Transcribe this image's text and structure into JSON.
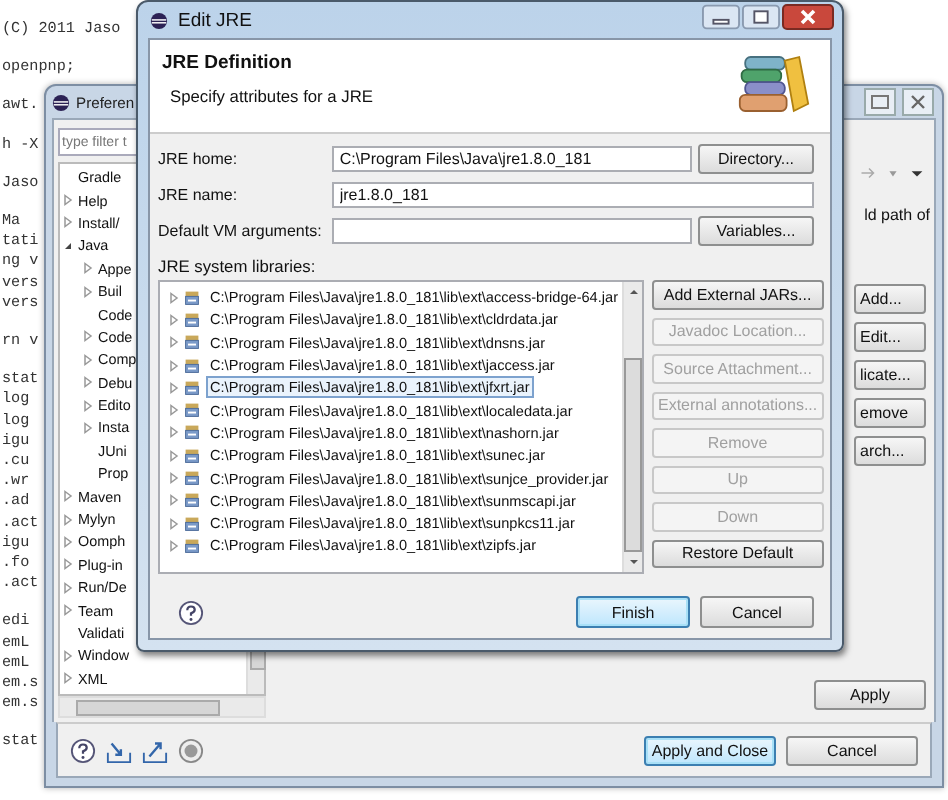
{
  "editor": {
    "blocks": [
      [
        "(C) 2011 Jaso"
      ],
      [
        "openpnp;"
      ],
      [
        "awt."
      ],
      [
        "h -X"
      ],
      [
        "Jaso"
      ],
      [
        "Ma",
        "tati",
        "ng v",
        "vers",
        "vers"
      ],
      [
        "rn v"
      ],
      [
        "stat",
        "log",
        "log",
        "igu",
        ".cu",
        ".wr",
        ".ad",
        ".act",
        "igu",
        ".fo",
        ".act"
      ],
      [
        "edi",
        "emL",
        "emL",
        "em.s",
        "em.s"
      ],
      [
        "stat"
      ]
    ]
  },
  "preferences": {
    "title": "Preferen",
    "filter": {
      "placeholder": "type filter t"
    },
    "tree": [
      {
        "label": "Gradle",
        "expandable": false
      },
      {
        "label": "Help",
        "expandable": true
      },
      {
        "label": "Install/",
        "expandable": true
      },
      {
        "label": "Java",
        "expandable": true,
        "expanded": true,
        "children": [
          {
            "label": "Appe",
            "expandable": true
          },
          {
            "label": "Buil",
            "expandable": true
          },
          {
            "label": "Code",
            "expandable": false
          },
          {
            "label": "Code",
            "expandable": true
          },
          {
            "label": "Comp",
            "expandable": true
          },
          {
            "label": "Debu",
            "expandable": true
          },
          {
            "label": "Edito",
            "expandable": true
          },
          {
            "label": "Insta",
            "expandable": true
          },
          {
            "label": "JUni",
            "expandable": false
          },
          {
            "label": "Prop",
            "expandable": false
          }
        ]
      },
      {
        "label": "Maven",
        "expandable": true
      },
      {
        "label": "Mylyn",
        "expandable": true
      },
      {
        "label": "Oomph",
        "expandable": true
      },
      {
        "label": "Plug-in",
        "expandable": true
      },
      {
        "label": "Run/De",
        "expandable": true
      },
      {
        "label": "Team",
        "expandable": true
      },
      {
        "label": "Validati",
        "expandable": false
      },
      {
        "label": "Window",
        "expandable": true
      },
      {
        "label": "XML",
        "expandable": true
      }
    ],
    "right_text": "ld path of",
    "side_buttons": [
      "Add...",
      "Edit...",
      "licate...",
      "emove",
      "arch..."
    ],
    "apply": "Apply",
    "buttons": [
      {
        "label": "Apply and Close",
        "default": true
      },
      {
        "label": "Cancel",
        "default": false
      }
    ]
  },
  "dialog": {
    "title": "Edit JRE",
    "heading": "JRE Definition",
    "description": "Specify attributes for a JRE",
    "fields": [
      {
        "label": "JRE home:",
        "value": "C:\\Program Files\\Java\\jre1.8.0_181",
        "button": "Directory..."
      },
      {
        "label": "JRE name:",
        "value": "jre1.8.0_181"
      },
      {
        "label": "Default VM arguments:",
        "button": "Variables..."
      }
    ],
    "libraries_label": "JRE system libraries:",
    "libraries": [
      {
        "path": "C:\\Program Files\\Java\\jre1.8.0_181\\lib\\ext\\access-bridge-64.jar",
        "selected": false
      },
      {
        "path": "C:\\Program Files\\Java\\jre1.8.0_181\\lib\\ext\\cldrdata.jar",
        "selected": false
      },
      {
        "path": "C:\\Program Files\\Java\\jre1.8.0_181\\lib\\ext\\dnsns.jar",
        "selected": false
      },
      {
        "path": "C:\\Program Files\\Java\\jre1.8.0_181\\lib\\ext\\jaccess.jar",
        "selected": false
      },
      {
        "path": "C:\\Program Files\\Java\\jre1.8.0_181\\lib\\ext\\jfxrt.jar",
        "selected": true
      },
      {
        "path": "C:\\Program Files\\Java\\jre1.8.0_181\\lib\\ext\\localedata.jar",
        "selected": false
      },
      {
        "path": "C:\\Program Files\\Java\\jre1.8.0_181\\lib\\ext\\nashorn.jar",
        "selected": false
      },
      {
        "path": "C:\\Program Files\\Java\\jre1.8.0_181\\lib\\ext\\sunec.jar",
        "selected": false
      },
      {
        "path": "C:\\Program Files\\Java\\jre1.8.0_181\\lib\\ext\\sunjce_provider.jar",
        "selected": false
      },
      {
        "path": "C:\\Program Files\\Java\\jre1.8.0_181\\lib\\ext\\sunmscapi.jar",
        "selected": false
      },
      {
        "path": "C:\\Program Files\\Java\\jre1.8.0_181\\lib\\ext\\sunpkcs11.jar",
        "selected": false
      },
      {
        "path": "C:\\Program Files\\Java\\jre1.8.0_181\\lib\\ext\\zipfs.jar",
        "selected": false
      }
    ],
    "side_buttons": [
      {
        "label": "Add External JARs...",
        "disabled": false
      },
      {
        "label": "Javadoc Location...",
        "disabled": true
      },
      {
        "label": "Source Attachment...",
        "disabled": true
      },
      {
        "label": "External annotations...",
        "disabled": true
      },
      {
        "label": "Remove",
        "disabled": true
      },
      {
        "label": "Up",
        "disabled": true
      },
      {
        "label": "Down",
        "disabled": true
      },
      {
        "label": "Restore Default",
        "disabled": false
      }
    ],
    "buttons": [
      {
        "label": "Finish",
        "default": true
      },
      {
        "label": "Cancel",
        "default": false
      }
    ]
  }
}
